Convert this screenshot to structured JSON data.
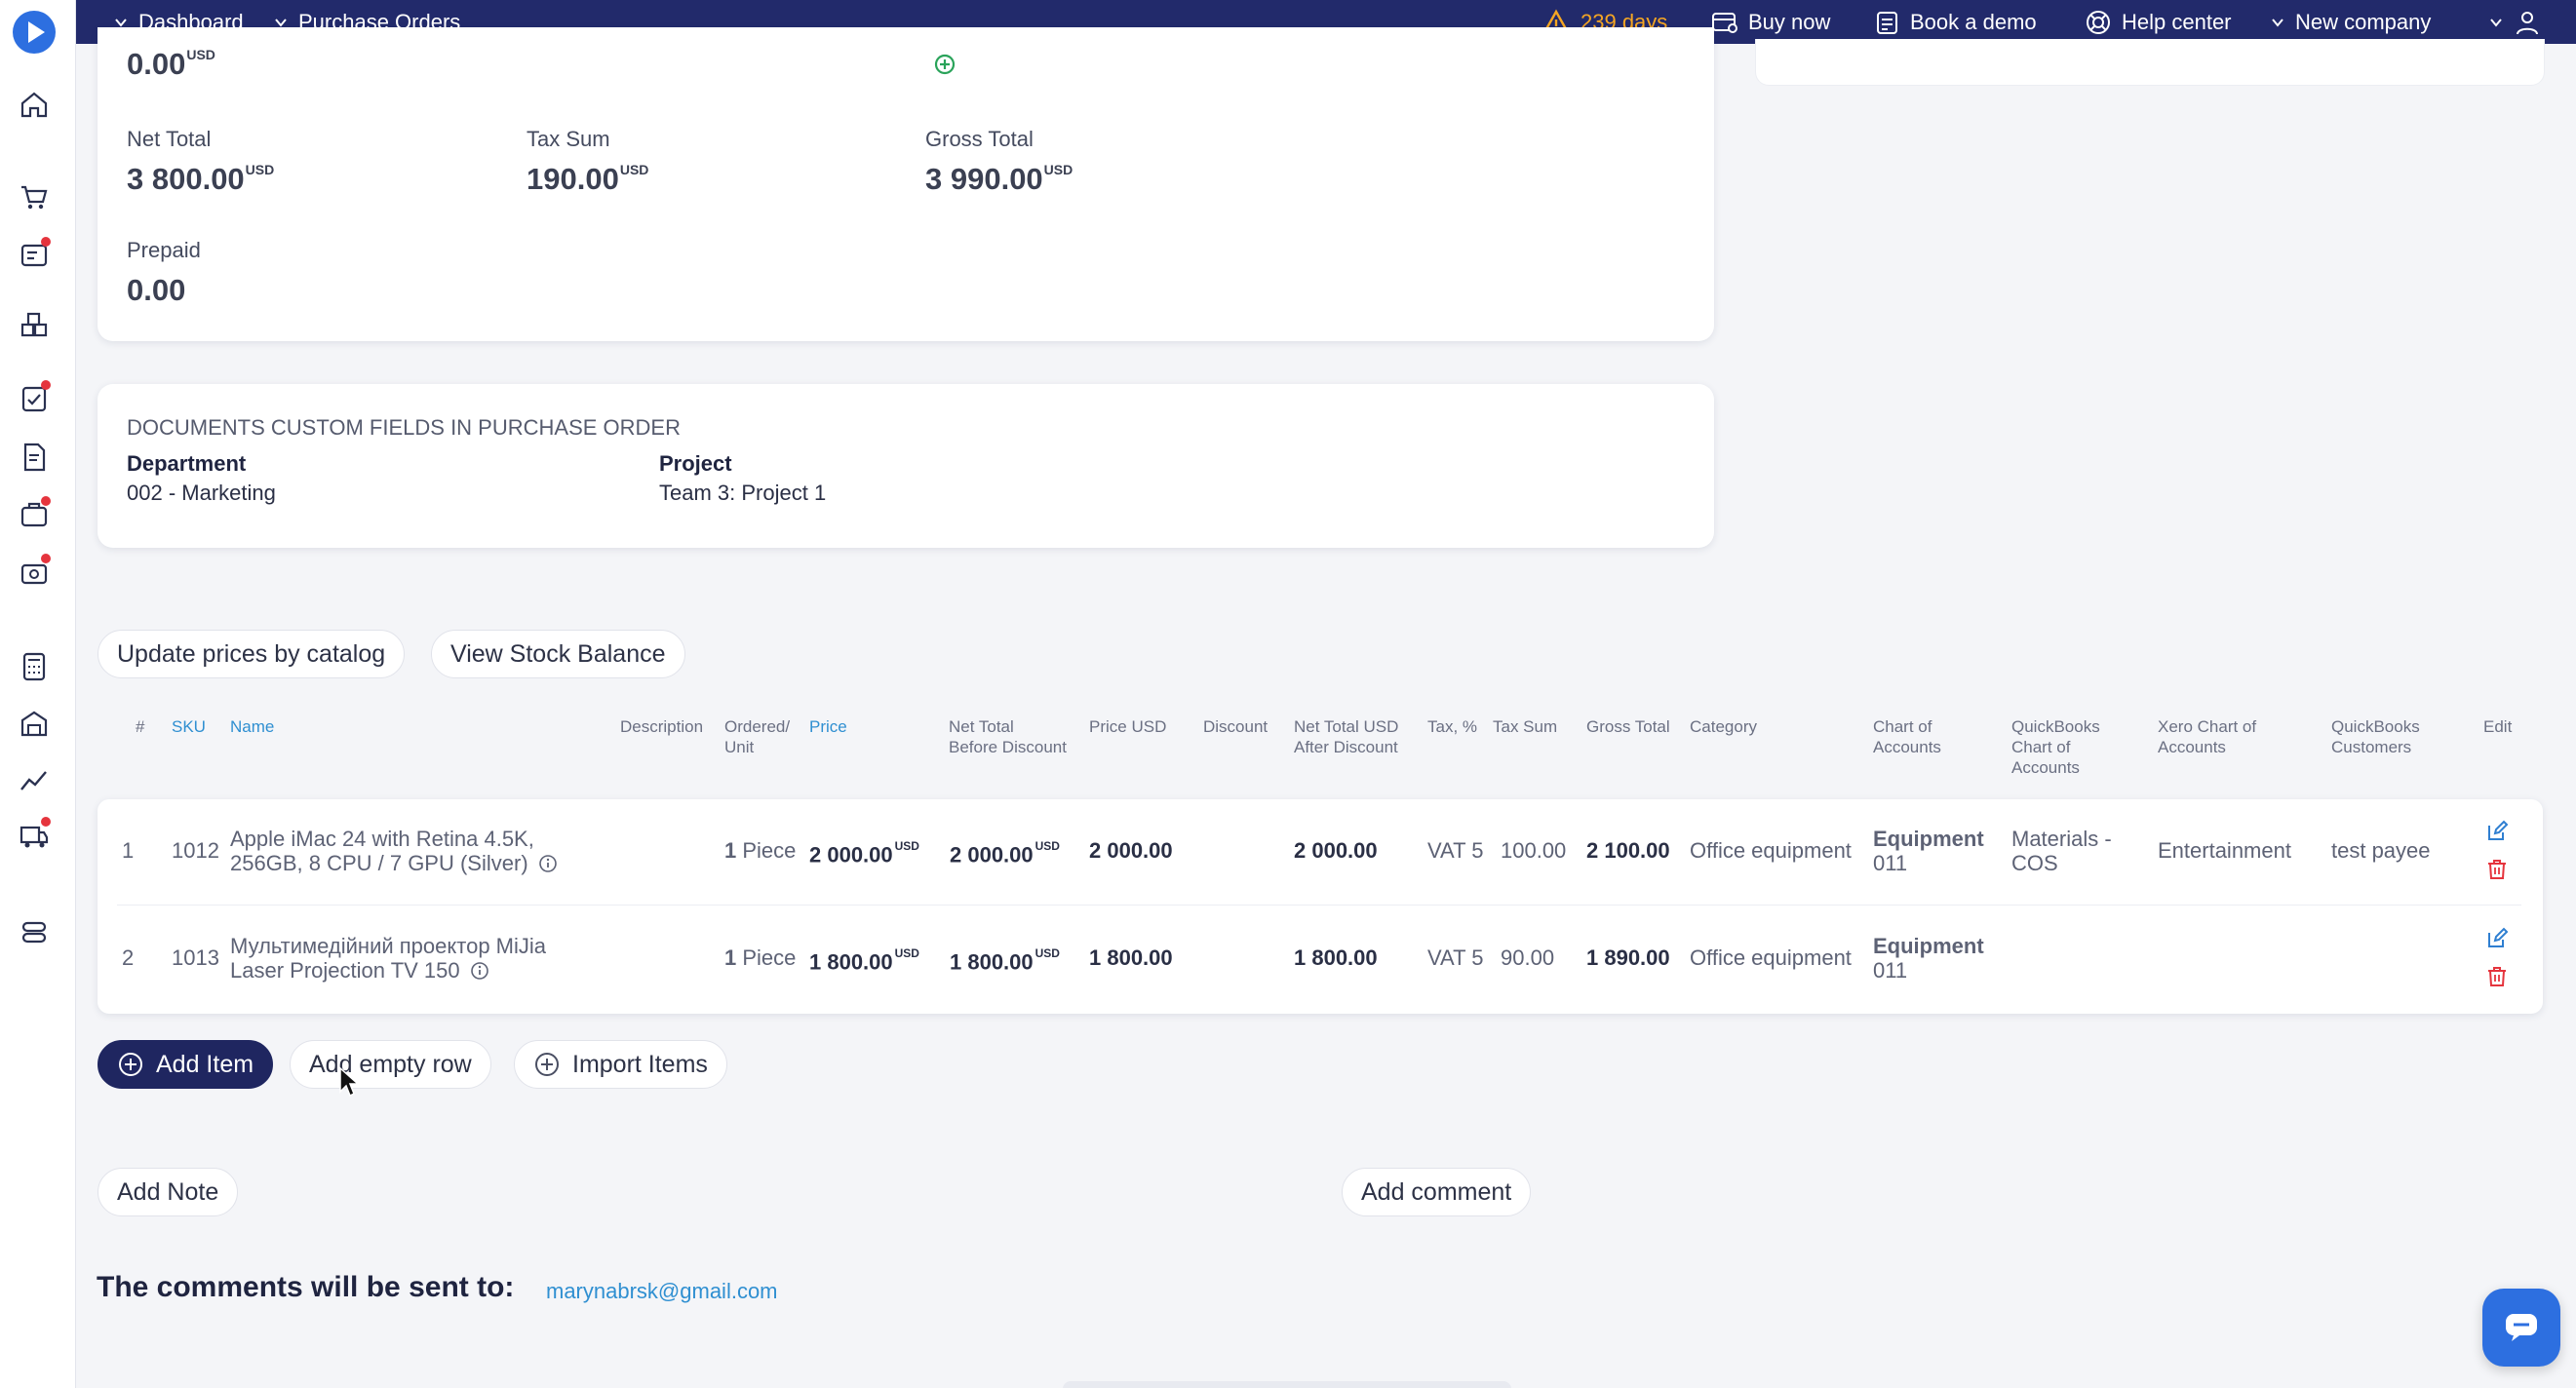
{
  "topbar": {
    "breadcrumb_1": "Dashboard",
    "breadcrumb_2": "Purchase Orders",
    "warning_text": "239 days",
    "buy_now": "Buy now",
    "book_demo": "Book a demo",
    "help_center": "Help center",
    "company": "New company"
  },
  "totals": {
    "top_partial_value": "0.00",
    "top_partial_currency": "USD",
    "net_total_label": "Net Total",
    "net_total_value": "3 800.00",
    "tax_sum_label": "Tax Sum",
    "tax_sum_value": "190.00",
    "gross_total_label": "Gross Total",
    "gross_total_value": "3 990.00",
    "currency": "USD",
    "prepaid_label": "Prepaid",
    "prepaid_value": "0.00"
  },
  "custom_fields": {
    "title": "DOCUMENTS CUSTOM FIELDS IN PURCHASE ORDER",
    "department_label": "Department",
    "department_value": "002 - Marketing",
    "project_label": "Project",
    "project_value": "Team 3: Project 1"
  },
  "actions": {
    "update_prices": "Update prices by catalog",
    "view_stock": "View Stock Balance",
    "add_item": "Add Item",
    "add_empty_row": "Add empty row",
    "import_items": "Import Items",
    "add_note": "Add Note",
    "add_comment": "Add comment"
  },
  "table": {
    "headers": {
      "num": "#",
      "sku": "SKU",
      "name": "Name",
      "description": "Description",
      "ordered_1": "Ordered/",
      "ordered_2": "Unit",
      "price": "Price",
      "net_before_1": "Net Total",
      "net_before_2": "Before Discount",
      "price_usd": "Price USD",
      "discount": "Discount",
      "net_after_1": "Net Total USD",
      "net_after_2": "After Discount",
      "tax_pct": "Tax, %",
      "tax_sum": "Tax Sum",
      "gross_total": "Gross Total",
      "category": "Category",
      "coa_1": "Chart of",
      "coa_2": "Accounts",
      "qb_coa_1": "QuickBooks",
      "qb_coa_2": "Chart of",
      "qb_coa_3": "Accounts",
      "xero_1": "Xero Chart of",
      "xero_2": "Accounts",
      "qb_cust_1": "QuickBooks",
      "qb_cust_2": "Customers",
      "edit": "Edit"
    },
    "rows": [
      {
        "num": "1",
        "sku": "1012",
        "name_1": "Apple iMac 24 with Retina 4.5K,",
        "name_2": "256GB, 8 CPU / 7 GPU (Silver)",
        "qty": "1",
        "unit": "Piece",
        "price": "2 000.00",
        "net_before": "2 000.00",
        "price_usd": "2 000.00",
        "net_after": "2 000.00",
        "tax": "VAT 5",
        "tax_sum": "100.00",
        "gross": "2 100.00",
        "category": "Office equipment",
        "coa_1": "Equipment",
        "coa_2": "011",
        "qb_coa_1": "Materials -",
        "qb_coa_2": "COS",
        "xero": "Entertainment",
        "qb_customer": "test payee",
        "currency": "USD"
      },
      {
        "num": "2",
        "sku": "1013",
        "name_1": "Мультимедійний проектор MiJia",
        "name_2": "Laser Projection TV 150",
        "qty": "1",
        "unit": "Piece",
        "price": "1 800.00",
        "net_before": "1 800.00",
        "price_usd": "1 800.00",
        "net_after": "1 800.00",
        "tax": "VAT 5",
        "tax_sum": "90.00",
        "gross": "1 890.00",
        "category": "Office equipment",
        "coa_1": "Equipment",
        "coa_2": "011",
        "currency": "USD"
      }
    ]
  },
  "comments": {
    "label": "The comments will be sent to:",
    "email": "marynabrsk@gmail.com"
  },
  "icons": {
    "logo": "play-logo",
    "warning": "warning-triangle-icon",
    "edit": "edit-pencil-icon",
    "delete": "trash-icon",
    "chat": "chat-bubble-icon"
  },
  "colors": {
    "topbar": "#222a6b",
    "accent_link": "#2f8fd1",
    "warning": "#f5a623",
    "danger": "#e5343d",
    "dark_button": "#1f2660"
  }
}
